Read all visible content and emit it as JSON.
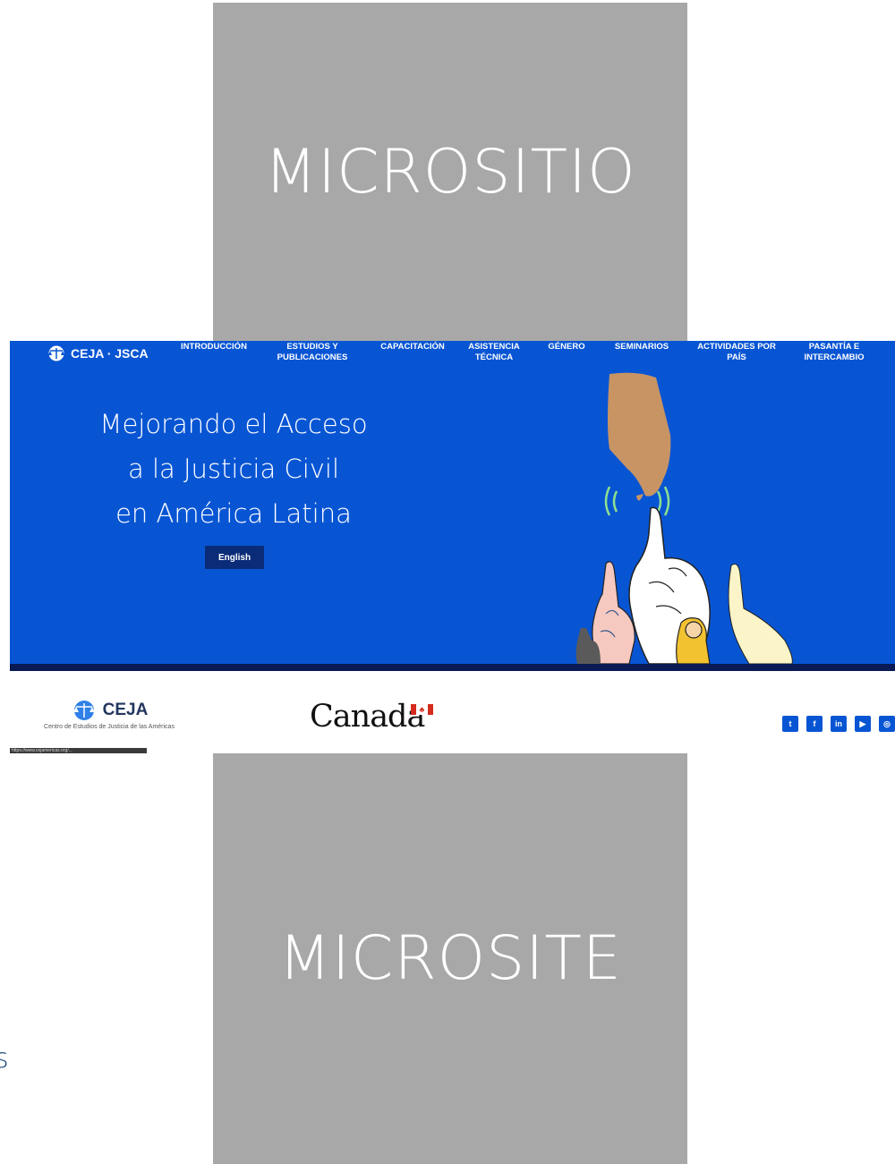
{
  "tiles": {
    "top_label": "MICROSITIO",
    "bottom_label": "MICROSITE"
  },
  "site": {
    "logo_text": "CEJA · JSCA",
    "nav": [
      {
        "label": "INTRODUCCIÓN"
      },
      {
        "label": "ESTUDIOS Y\nPUBLICACIONES"
      },
      {
        "label": "CAPACITACIÓN"
      },
      {
        "label": "ASISTENCIA\nTÉCNICA"
      },
      {
        "label": "GÉNERO"
      },
      {
        "label": "SEMINARIOS"
      },
      {
        "label": "ACTIVIDADES POR\nPAÍS"
      },
      {
        "label": "PASANTÍA E\nINTERCAMBIO"
      }
    ],
    "hero_title": "Mejorando el Acceso\na la Justicia Civil\nen América Latina",
    "language_button": "English"
  },
  "footer": {
    "ceja_name": "CEJA",
    "ceja_subtitle": "Centro de Estudios de Justicia de las Américas",
    "url_hint": "https://www.cejamericas.org/...",
    "canada_wordmark": "Canada",
    "social_icons": [
      "twitter-icon",
      "facebook-icon",
      "linkedin-icon",
      "youtube-icon",
      "instagram-icon"
    ]
  },
  "edge_text": "s",
  "colors": {
    "accent_blue": "#0855d4",
    "tile_gray": "#a8a8a8",
    "button_navy": "#0a2c78"
  }
}
